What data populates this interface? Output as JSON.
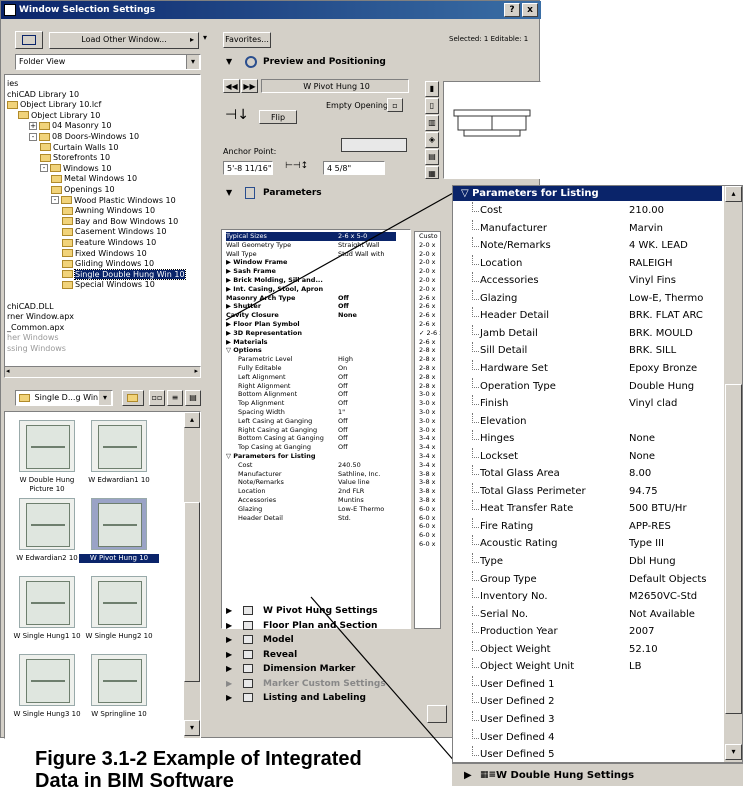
{
  "window": {
    "title": "Window Selection Settings",
    "help": "?",
    "close": "x"
  },
  "toolbar": {
    "load_other": "Load Other Window...",
    "folder_view": "Folder View",
    "favorites": "Favorites...",
    "selected": "Selected: 1 Editable: 1"
  },
  "tree": [
    {
      "t": "ies",
      "d": 0,
      "f": false
    },
    {
      "t": "chiCAD Library 10",
      "d": 0,
      "f": false
    },
    {
      "t": "Object Library 10.lcf",
      "d": 0,
      "f": true
    },
    {
      "t": "Object Library 10",
      "d": 1,
      "f": true
    },
    {
      "t": "04 Masonry 10",
      "d": 2,
      "f": true,
      "p": "+"
    },
    {
      "t": "08 Doors-Windows 10",
      "d": 2,
      "f": true,
      "p": "-"
    },
    {
      "t": "Curtain Walls 10",
      "d": 3,
      "f": true
    },
    {
      "t": "Storefronts 10",
      "d": 3,
      "f": true
    },
    {
      "t": "Windows 10",
      "d": 3,
      "f": true,
      "p": "-"
    },
    {
      "t": "Metal Windows 10",
      "d": 4,
      "f": true
    },
    {
      "t": "Openings 10",
      "d": 4,
      "f": true
    },
    {
      "t": "Wood Plastic Windows 10",
      "d": 4,
      "f": true,
      "p": "-"
    },
    {
      "t": "Awning Windows 10",
      "d": 5,
      "f": true
    },
    {
      "t": "Bay and Bow Windows 10",
      "d": 5,
      "f": true
    },
    {
      "t": "Casement Windows 10",
      "d": 5,
      "f": true
    },
    {
      "t": "Feature Windows 10",
      "d": 5,
      "f": true
    },
    {
      "t": "Fixed Windows 10",
      "d": 5,
      "f": true
    },
    {
      "t": "Gliding Windows 10",
      "d": 5,
      "f": true
    },
    {
      "t": "Single Double Hung Win 10",
      "d": 5,
      "f": true,
      "s": true
    },
    {
      "t": "Special Windows 10",
      "d": 5,
      "f": true
    },
    {
      "t": "",
      "d": 0,
      "f": false
    },
    {
      "t": "chiCAD.DLL",
      "d": 0,
      "f": false
    },
    {
      "t": "rner Window.apx",
      "d": 0,
      "f": false
    },
    {
      "t": "_Common.apx",
      "d": 0,
      "f": false
    },
    {
      "t": "her Windows",
      "d": 0,
      "f": false,
      "g": true
    },
    {
      "t": "ssing Windows",
      "d": 0,
      "f": false,
      "g": true
    }
  ],
  "lib_select": "Single D...g Win 10",
  "thumbs": [
    {
      "label": "W Double Hung Picture 10"
    },
    {
      "label": "W Edwardian1 10"
    },
    {
      "label": "W Edwardian2 10"
    },
    {
      "label": "W Pivot Hung 10",
      "sel": true
    },
    {
      "label": "W Single Hung1 10"
    },
    {
      "label": "W Single Hung2 10"
    },
    {
      "label": "W Single Hung3 10"
    },
    {
      "label": "W Springline 10"
    }
  ],
  "preview": {
    "section": "Preview and Positioning",
    "name": "W Pivot Hung 10",
    "empty_opening": "Empty Opening",
    "flip": "Flip",
    "anchor": "Anchor Point:",
    "anchor_val": "5'-8 11/16\"",
    "dim_val": "4 5/8\""
  },
  "params": {
    "section": "Parameters",
    "rows": [
      {
        "n": "Typical Sizes",
        "v": "2-6 x 5-0",
        "sel": true
      },
      {
        "n": "Wall Geometry Type",
        "v": "Straight Wall"
      },
      {
        "n": "Wall Type",
        "v": "Stud Wall with"
      },
      {
        "n": "▶ Window Frame",
        "v": "",
        "b": true
      },
      {
        "n": "▶ Sash Frame",
        "v": "",
        "b": true
      },
      {
        "n": "▶ Brick Molding, Sill and...",
        "v": "",
        "b": true
      },
      {
        "n": "▶ Int. Casing, Stool, Apron",
        "v": "",
        "b": true
      },
      {
        "n": "Masonry Arch Type",
        "v": "Off",
        "b": true
      },
      {
        "n": "▶ Shutter",
        "v": "Off",
        "b": true
      },
      {
        "n": "Cavity Closure",
        "v": "None",
        "b": true
      },
      {
        "n": "▶ Floor Plan Symbol",
        "v": "",
        "b": true
      },
      {
        "n": "▶ 3D Representation",
        "v": "",
        "b": true
      },
      {
        "n": "▶ Materials",
        "v": "",
        "b": true
      },
      {
        "n": "▽ Options",
        "v": "",
        "b": true
      },
      {
        "n": "Parametric Level",
        "v": "High",
        "i": true
      },
      {
        "n": "Fully Editable",
        "v": "On",
        "i": true
      },
      {
        "n": "Left Alignment",
        "v": "Off",
        "i": true
      },
      {
        "n": "Right Alignment",
        "v": "Off",
        "i": true
      },
      {
        "n": "Bottom Alignment",
        "v": "Off",
        "i": true
      },
      {
        "n": "Top Alignment",
        "v": "Off",
        "i": true
      },
      {
        "n": "Spacing Width",
        "v": "1\"",
        "i": true
      },
      {
        "n": "Left Casing at Ganging",
        "v": "Off",
        "i": true
      },
      {
        "n": "Right Casing at Ganging",
        "v": "Off",
        "i": true
      },
      {
        "n": "Bottom Casing at Ganging",
        "v": "Off",
        "i": true
      },
      {
        "n": "Top Casing at Ganging",
        "v": "Off",
        "i": true
      },
      {
        "n": "▽ Parameters for Listing",
        "v": "",
        "b": true
      },
      {
        "n": "Cost",
        "v": "240.50",
        "i": true
      },
      {
        "n": "Manufacturer",
        "v": "Sathline, Inc.",
        "i": true
      },
      {
        "n": "Note/Remarks",
        "v": "Value line",
        "i": true
      },
      {
        "n": "Location",
        "v": "2nd FLR",
        "i": true
      },
      {
        "n": "Accessories",
        "v": "Muntins",
        "i": true
      },
      {
        "n": "Glazing",
        "v": "Low-E Thermo",
        "i": true
      },
      {
        "n": "Header Detail",
        "v": "Std.",
        "i": true
      }
    ]
  },
  "sizes": [
    "Custo",
    "2-0 x",
    "2-0 x",
    "2-0 x",
    "2-0 x",
    "2-0 x",
    "2-0 x",
    "2-6 x",
    "2-6 x",
    "2-6 x",
    "2-6 x",
    "✓ 2-6 x",
    "2-6 x",
    "2-8 x",
    "2-8 x",
    "2-8 x",
    "2-8 x",
    "2-8 x",
    "3-0 x",
    "3-0 x",
    "3-0 x",
    "3-0 x",
    "3-0 x",
    "3-4 x",
    "3-4 x",
    "3-4 x",
    "3-4 x",
    "3-8 x",
    "3-8 x",
    "3-8 x",
    "3-8 x",
    "6-0 x",
    "6-0 x",
    "6-0 x",
    "6-0 x",
    "6-0 x"
  ],
  "sections_below": [
    {
      "label": "W Pivot Hung Settings"
    },
    {
      "label": "Floor Plan and Section"
    },
    {
      "label": "Model"
    },
    {
      "label": "Reveal"
    },
    {
      "label": "Dimension Marker"
    },
    {
      "label": "Marker Custom Settings",
      "disabled": true
    },
    {
      "label": "Listing and Labeling"
    }
  ],
  "listing": {
    "title": "▽ Parameters for Listing",
    "rows": [
      {
        "n": "Cost",
        "v": "210.00"
      },
      {
        "n": "Manufacturer",
        "v": "Marvin"
      },
      {
        "n": "Note/Remarks",
        "v": "4 WK. LEAD"
      },
      {
        "n": "Location",
        "v": "RALEIGH"
      },
      {
        "n": "Accessories",
        "v": "Vinyl Fins"
      },
      {
        "n": "Glazing",
        "v": "Low-E, Thermo"
      },
      {
        "n": "Header Detail",
        "v": "BRK. FLAT ARC"
      },
      {
        "n": "Jamb Detail",
        "v": "BRK. MOULD"
      },
      {
        "n": "Sill Detail",
        "v": "BRK. SILL"
      },
      {
        "n": "Hardware Set",
        "v": "Epoxy Bronze"
      },
      {
        "n": "Operation Type",
        "v": "Double Hung"
      },
      {
        "n": "Finish",
        "v": "Vinyl clad"
      },
      {
        "n": "Elevation",
        "v": ""
      },
      {
        "n": "Hinges",
        "v": "None"
      },
      {
        "n": "Lockset",
        "v": "None"
      },
      {
        "n": "Total Glass Area",
        "v": "8.00"
      },
      {
        "n": "Total Glass Perimeter",
        "v": "94.75"
      },
      {
        "n": "Heat Transfer Rate",
        "v": "500 BTU/Hr"
      },
      {
        "n": "Fire Rating",
        "v": "APP-RES"
      },
      {
        "n": "Acoustic Rating",
        "v": "Type III"
      },
      {
        "n": "Type",
        "v": "Dbl Hung"
      },
      {
        "n": "Group Type",
        "v": "Default Objects"
      },
      {
        "n": "Inventory No.",
        "v": "M2650VC-Std"
      },
      {
        "n": "Serial No.",
        "v": "Not Available"
      },
      {
        "n": "Production Year",
        "v": "2007"
      },
      {
        "n": "Object Weight",
        "v": "52.10"
      },
      {
        "n": "Object Weight Unit",
        "v": "LB"
      },
      {
        "n": "User Defined 1",
        "v": ""
      },
      {
        "n": "User Defined 2",
        "v": ""
      },
      {
        "n": "User Defined 3",
        "v": ""
      },
      {
        "n": "User Defined 4",
        "v": ""
      },
      {
        "n": "User Defined 5",
        "v": ""
      }
    ],
    "bottom_label": "W Double Hung Settings"
  },
  "caption": {
    "line1": "Figure 3.1-2  Example of Integrated",
    "line2": "Data in BIM Software"
  }
}
